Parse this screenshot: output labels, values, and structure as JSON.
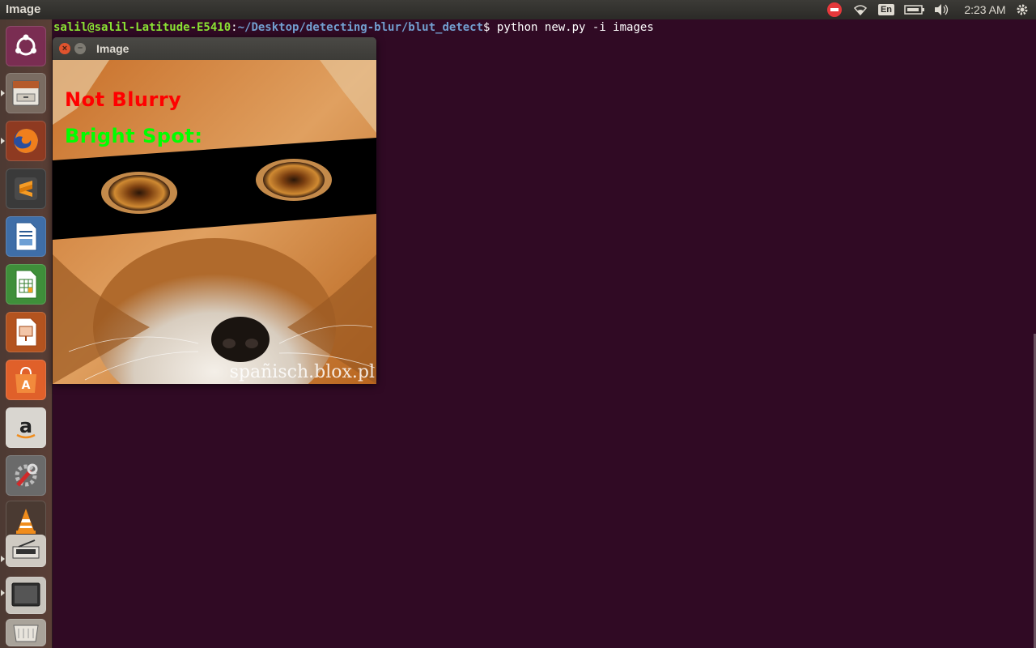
{
  "topbar": {
    "app_title": "Image",
    "language": "En",
    "clock": "2:23 AM"
  },
  "launcher": {
    "items": [
      {
        "name": "dash-home",
        "icon": "ubuntu-logo-icon"
      },
      {
        "name": "files",
        "icon": "file-cabinet-icon"
      },
      {
        "name": "firefox",
        "icon": "firefox-icon"
      },
      {
        "name": "sublime-text",
        "icon": "sublime-text-icon"
      },
      {
        "name": "libreoffice-writer",
        "icon": "writer-icon"
      },
      {
        "name": "libreoffice-calc",
        "icon": "calc-icon"
      },
      {
        "name": "libreoffice-impress",
        "icon": "impress-icon"
      },
      {
        "name": "software-center",
        "icon": "shopping-bag-icon"
      },
      {
        "name": "amazon",
        "icon": "amazon-icon"
      },
      {
        "name": "system-settings",
        "icon": "wrench-icon"
      },
      {
        "name": "vlc",
        "icon": "vlc-cone-icon"
      },
      {
        "name": "scanner",
        "icon": "scanner-icon"
      },
      {
        "name": "image-viewer",
        "icon": "monitor-icon"
      },
      {
        "name": "trash",
        "icon": "trash-icon"
      }
    ]
  },
  "terminal": {
    "user_host": "salil@salil-Latitude-E5410",
    "colon": ":",
    "path": "~/Desktop/detecting-blur/blut_detect",
    "prompt": "$",
    "command": " python new.py -i images"
  },
  "window": {
    "title": "Image",
    "overlay_blurry": "Not Blurry",
    "overlay_bright": "Bright Spot:",
    "watermark": "spañisch.blox.pl"
  },
  "colors": {
    "desktop_bg": "#300a24",
    "blurry_label": "#ff0000",
    "bright_label": "#00ff00",
    "prompt_user": "#8ae234",
    "prompt_path": "#729fcf"
  }
}
